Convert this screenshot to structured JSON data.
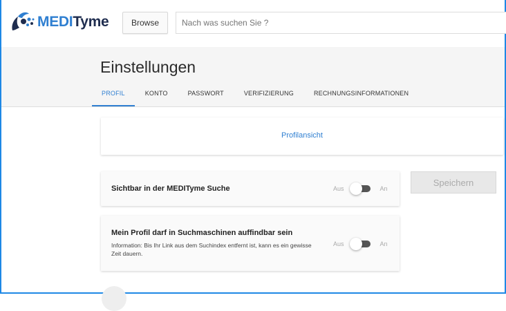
{
  "header": {
    "logo_prefix": "MEDI",
    "logo_suffix": "Tyme",
    "browse_label": "Browse",
    "search_placeholder": "Nach was suchen Sie ?"
  },
  "page": {
    "title": "Einstellungen",
    "tabs": [
      {
        "label": "PROFIL",
        "active": true
      },
      {
        "label": "KONTO",
        "active": false
      },
      {
        "label": "PASSWORT",
        "active": false
      },
      {
        "label": "VERIFIZIERUNG",
        "active": false
      },
      {
        "label": "RECHNUNGSINFORMATIONEN",
        "active": false
      }
    ]
  },
  "profile_view": {
    "link_label": "Profilansicht"
  },
  "settings": [
    {
      "label": "Sichtbar in der MEDITyme Suche",
      "info": "",
      "off_label": "Aus",
      "on_label": "An"
    },
    {
      "label": "Mein Profil darf in Suchmaschinen auffindbar sein",
      "info": "Information: Bis Ihr Link aus dem Suchindex entfernt ist, kann es ein gewisse Zeit dauern.",
      "off_label": "Aus",
      "on_label": "An"
    }
  ],
  "save_label": "Speichern",
  "colors": {
    "accent": "#2f7fd1",
    "logo_dark": "#1f2d4f",
    "frame": "#1e88e5"
  },
  "icons": {
    "logo": "meditymed-logo-icon"
  }
}
